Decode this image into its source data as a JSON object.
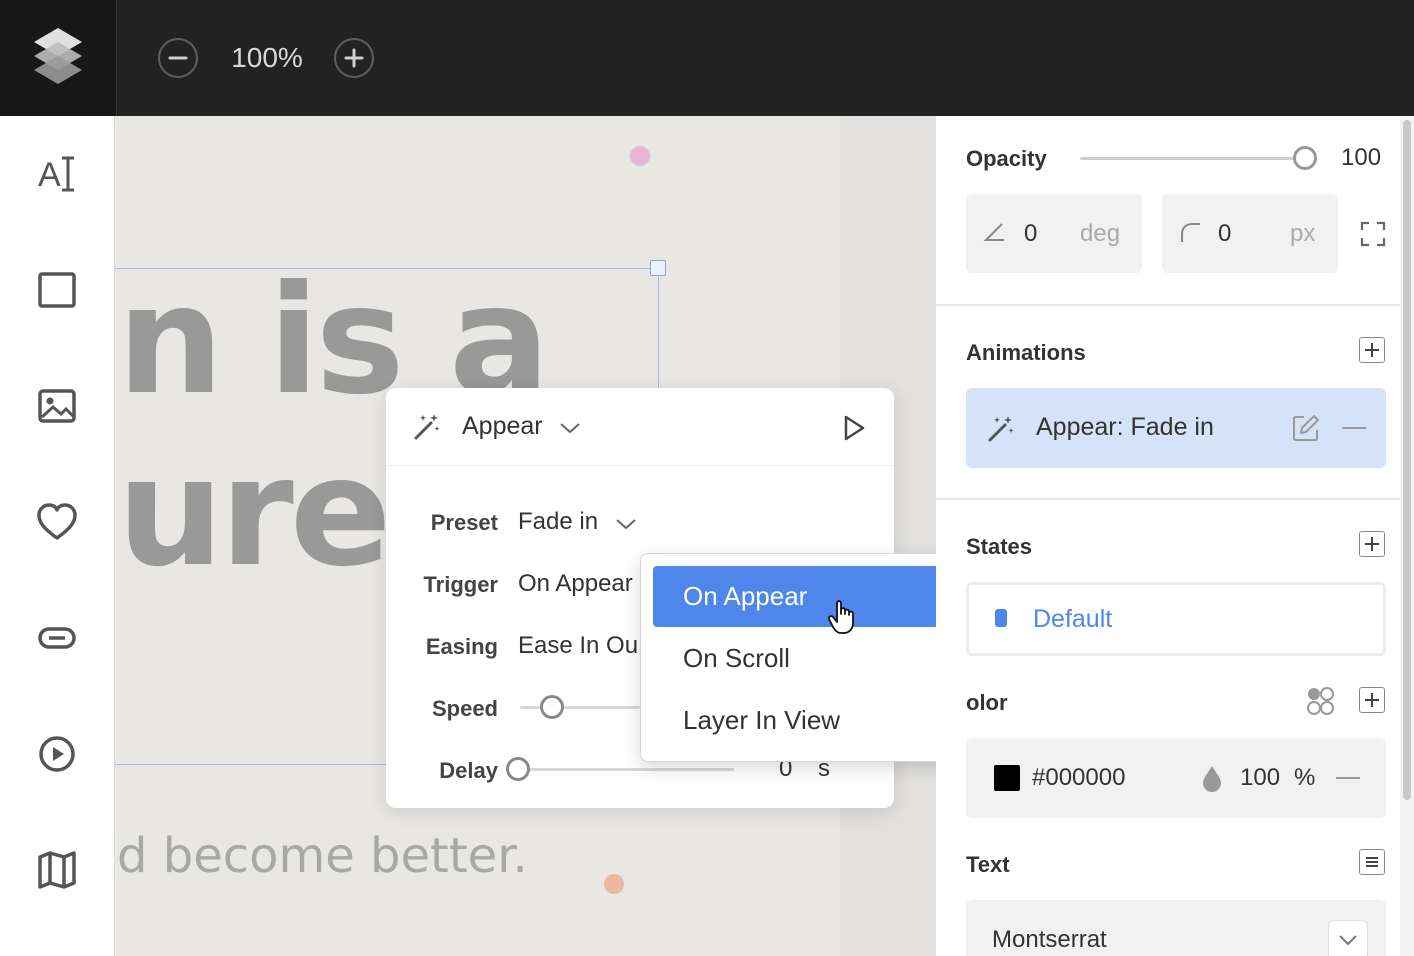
{
  "topbar": {
    "zoom_level": "100%"
  },
  "canvas": {
    "heading_line1": "n is a",
    "heading_line2": "ure",
    "subtext": "d become better."
  },
  "animation_popup": {
    "type_label": "Appear",
    "preset_label": "Preset",
    "preset_value": "Fade in",
    "trigger_label": "Trigger",
    "trigger_value": "On Appear",
    "easing_label": "Easing",
    "easing_value": "Ease In Ou",
    "speed_label": "Speed",
    "delay_label": "Delay",
    "delay_value": "0",
    "delay_unit": "s"
  },
  "trigger_dropdown": {
    "options": [
      "On Appear",
      "On Scroll",
      "Layer In View"
    ],
    "selected": "On Appear"
  },
  "right_panel": {
    "opacity_label": "Opacity",
    "opacity_value": "100",
    "rotation_value": "0",
    "rotation_unit": "deg",
    "radius_value": "0",
    "radius_unit": "px",
    "animations_label": "Animations",
    "animation_item": "Appear: Fade in",
    "states_label": "States",
    "state_item": "Default",
    "color_label": "olor",
    "color_hex": "#000000",
    "color_opacity": "100",
    "color_opacity_unit": "%",
    "text_label": "Text",
    "font_family": "Montserrat"
  },
  "colors": {
    "accent": "#4f86ec",
    "animation_item_bg": "#d6e2f8",
    "topbar_bg": "#222222",
    "canvas_bg": "#e9e7e4"
  }
}
